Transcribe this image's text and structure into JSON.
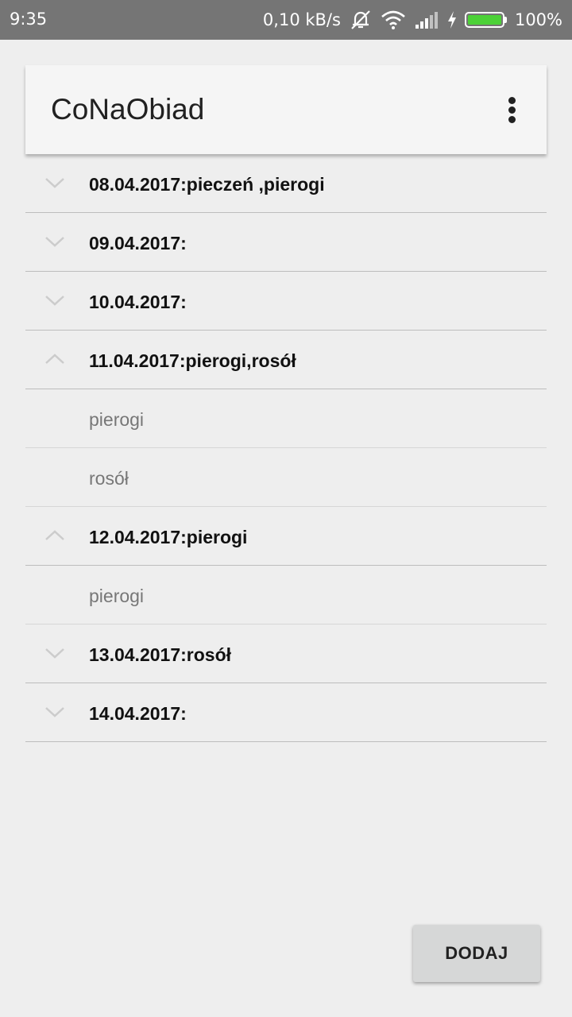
{
  "status_bar": {
    "time": "9:35",
    "speed": "0,10 kB/s",
    "battery": "100%",
    "battery_level": 1.0,
    "icons": [
      "silent-mode-icon",
      "wifi-icon",
      "signal-icon",
      "charging-icon",
      "battery-icon"
    ],
    "battery_color": "#4cd137"
  },
  "app_bar": {
    "title": "CoNaObiad",
    "menu_icon": "overflow-menu-icon"
  },
  "list": {
    "groups": [
      {
        "title": "08.04.2017:pieczeń ,pierogi",
        "expanded": false,
        "children": []
      },
      {
        "title": "09.04.2017:",
        "expanded": false,
        "children": []
      },
      {
        "title": "10.04.2017:",
        "expanded": false,
        "children": []
      },
      {
        "title": "11.04.2017:pierogi,rosół",
        "expanded": true,
        "children": [
          "pierogi",
          "rosół"
        ]
      },
      {
        "title": "12.04.2017:pierogi",
        "expanded": true,
        "children": [
          "pierogi"
        ]
      },
      {
        "title": "13.04.2017:rosół",
        "expanded": false,
        "children": []
      },
      {
        "title": "14.04.2017:",
        "expanded": false,
        "children": []
      }
    ]
  },
  "actions": {
    "add_label": "DODAJ"
  }
}
